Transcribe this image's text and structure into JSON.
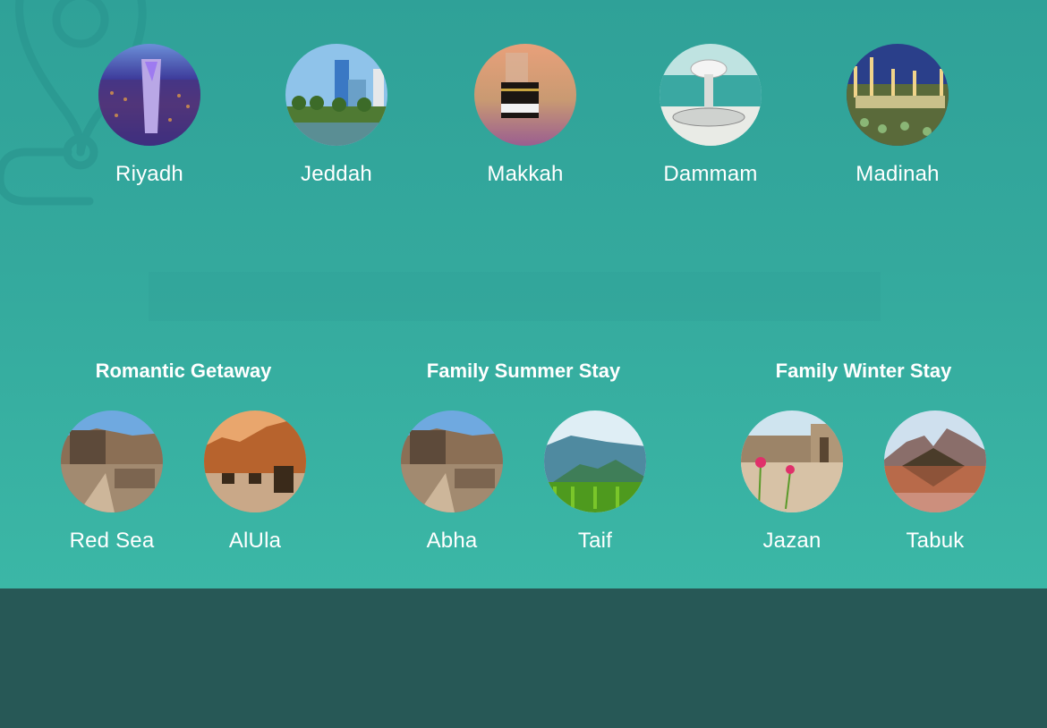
{
  "colors": {
    "hero_top": "#2fa198",
    "hero_bottom": "#3bb7a6",
    "footer": "#275856",
    "text": "#ffffff"
  },
  "decoration": {
    "icon": "map-pin-route-icon"
  },
  "top_cities": [
    {
      "name": "Riyadh",
      "image": "kingdom-tower-night"
    },
    {
      "name": "Jeddah",
      "image": "corniche-towers"
    },
    {
      "name": "Makkah",
      "image": "kaaba"
    },
    {
      "name": "Dammam",
      "image": "water-tower"
    },
    {
      "name": "Madinah",
      "image": "prophets-mosque-night"
    }
  ],
  "groups": [
    {
      "title": "Romantic Getaway",
      "destinations": [
        {
          "name": "Red Sea",
          "image": "mountain-village"
        },
        {
          "name": "AlUla",
          "image": "sandstone-cliffs"
        }
      ]
    },
    {
      "title": "Family Summer Stay",
      "destinations": [
        {
          "name": "Abha",
          "image": "mountain-village"
        },
        {
          "name": "Taif",
          "image": "green-mountains"
        }
      ]
    },
    {
      "title": "Family Winter Stay",
      "destinations": [
        {
          "name": "Jazan",
          "image": "stone-courtyard-flowers"
        },
        {
          "name": "Tabuk",
          "image": "mountain-lake-reflection"
        }
      ]
    }
  ]
}
